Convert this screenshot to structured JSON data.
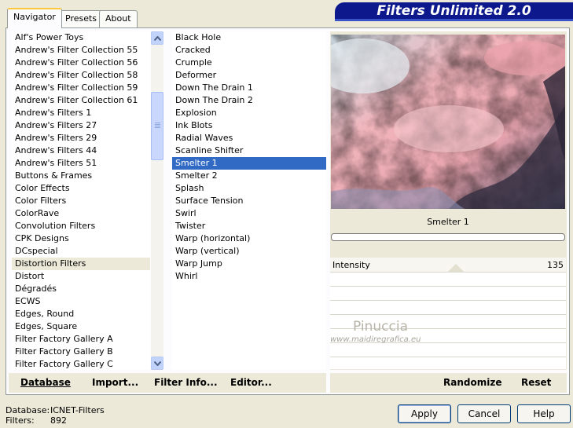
{
  "banner": {
    "title": "Filters Unlimited 2.0"
  },
  "tabs": [
    {
      "label": "Navigator",
      "active": true
    },
    {
      "label": "Presets",
      "active": false
    },
    {
      "label": "About",
      "active": false
    }
  ],
  "categories": {
    "highlighted": "Distortion Filters",
    "items": [
      "Alf's Power Toys",
      "Andrew's Filter Collection 55",
      "Andrew's Filter Collection 56",
      "Andrew's Filter Collection 58",
      "Andrew's Filter Collection 59",
      "Andrew's Filter Collection 61",
      "Andrew's Filters 1",
      "Andrew's Filters 27",
      "Andrew's Filters 29",
      "Andrew's Filters 44",
      "Andrew's Filters 51",
      "Buttons & Frames",
      "Color Effects",
      "Color Filters",
      "ColorRave",
      "Convolution Filters",
      "CPK Designs",
      "DCspecial",
      "Distortion Filters",
      "Distort",
      "Dégradés",
      "ECWS",
      "Edges, Round",
      "Edges, Square",
      "Filter Factory Gallery A",
      "Filter Factory Gallery B",
      "Filter Factory Gallery C"
    ]
  },
  "filters": {
    "selected": "Smelter 1",
    "items": [
      "Black Hole",
      "Cracked",
      "Crumple",
      "Deformer",
      "Down The Drain 1",
      "Down The Drain 2",
      "Explosion",
      "Ink Blots",
      "Radial Waves",
      "Scanline Shifter",
      "Smelter 1",
      "Smelter 2",
      "Splash",
      "Surface Tension",
      "Swirl",
      "Twister",
      "Warp (horizontal)",
      "Warp (vertical)",
      "Warp Jump",
      "Whirl"
    ]
  },
  "preview": {
    "filter_name": "Smelter 1",
    "progress": 0
  },
  "parameters": [
    {
      "label": "Intensity",
      "value": "135"
    }
  ],
  "left_buttons": {
    "database": "Database",
    "import": "Import...",
    "filter_info": "Filter Info...",
    "editor": "Editor..."
  },
  "right_buttons": {
    "randomize": "Randomize",
    "reset": "Reset"
  },
  "footer": {
    "database_label": "Database:",
    "database_value": "ICNET-Filters",
    "filters_label": "Filters:",
    "filters_value": "892"
  },
  "dialog_buttons": {
    "apply": "Apply",
    "cancel": "Cancel",
    "help": "Help"
  },
  "watermark": {
    "name": "Pinuccia",
    "url": "www.maidiregrafica.eu"
  }
}
